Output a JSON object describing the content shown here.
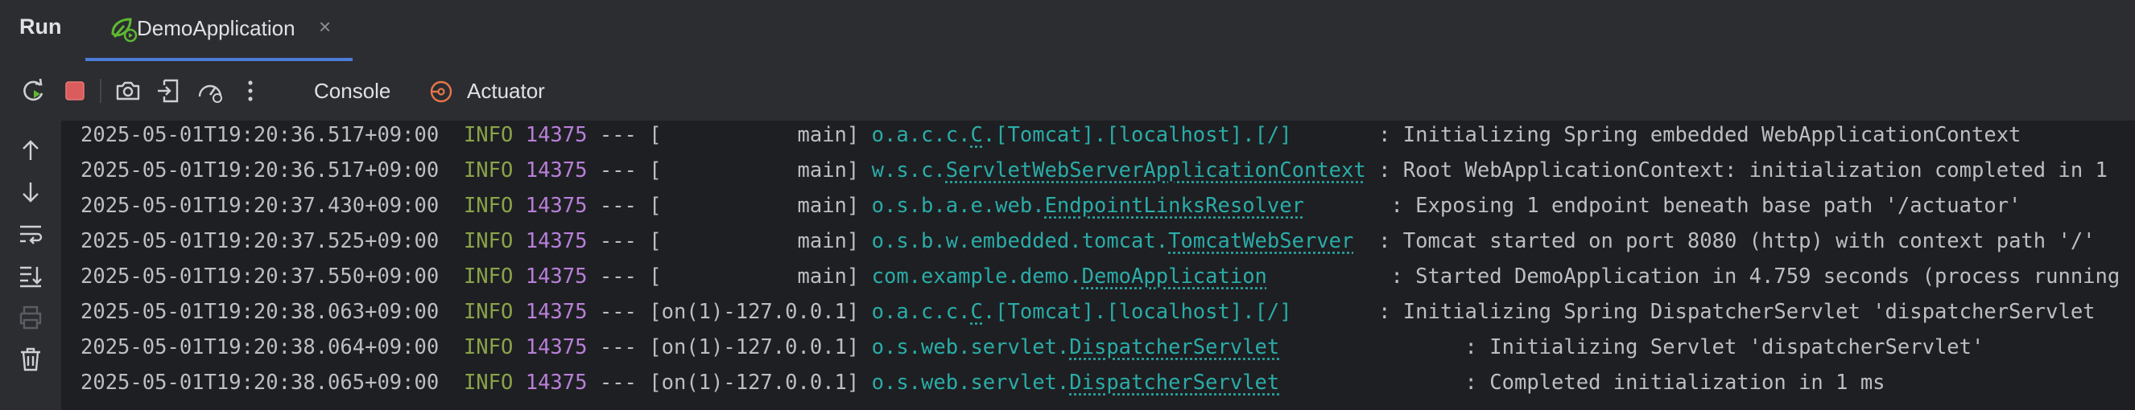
{
  "panel_title": "Run",
  "tab": {
    "label": "DemoApplication",
    "close": "×"
  },
  "toolbar": {
    "subtabs": [
      {
        "label": "Console"
      },
      {
        "label": "Actuator"
      }
    ]
  },
  "colors": {
    "background": "#1e1f22",
    "panel": "#2b2d30",
    "info": "#8aa34a",
    "pid": "#b87fd8",
    "logger": "#2aaca8",
    "stop": "#db5c5c"
  },
  "log": [
    {
      "ts": "2025-05-01T19:20:36.517+09:00",
      "level": "INFO",
      "pid": "14375",
      "sep": "---",
      "thread": "[           main]",
      "logger_pre": "o.a.c.c.",
      "logger_ul": "C",
      "logger_post": ".[Tomcat].[localhost].[/]      ",
      "msg": " : Initializing Spring embedded WebApplicationContext"
    },
    {
      "ts": "2025-05-01T19:20:36.517+09:00",
      "level": "INFO",
      "pid": "14375",
      "sep": "---",
      "thread": "[           main]",
      "logger_pre": "w.s.c.",
      "logger_ul": "ServletWebServerApplicationContext",
      "logger_post": "",
      "msg": " : Root WebApplicationContext: initialization completed in 1"
    },
    {
      "ts": "2025-05-01T19:20:37.430+09:00",
      "level": "INFO",
      "pid": "14375",
      "sep": "---",
      "thread": "[           main]",
      "logger_pre": "o.s.b.a.e.web.",
      "logger_ul": "EndpointLinksResolver",
      "logger_post": "      ",
      "msg": " : Exposing 1 endpoint beneath base path '/actuator'"
    },
    {
      "ts": "2025-05-01T19:20:37.525+09:00",
      "level": "INFO",
      "pid": "14375",
      "sep": "---",
      "thread": "[           main]",
      "logger_pre": "o.s.b.w.embedded.tomcat.",
      "logger_ul": "TomcatWebServer",
      "logger_post": " ",
      "msg": " : Tomcat started on port 8080 (http) with context path '/'"
    },
    {
      "ts": "2025-05-01T19:20:37.550+09:00",
      "level": "INFO",
      "pid": "14375",
      "sep": "---",
      "thread": "[           main]",
      "logger_pre": "com.example.demo.",
      "logger_ul": "DemoApplication",
      "logger_post": "         ",
      "msg": " : Started DemoApplication in 4.759 seconds (process running"
    },
    {
      "ts": "2025-05-01T19:20:38.063+09:00",
      "level": "INFO",
      "pid": "14375",
      "sep": "---",
      "thread": "[on(1)-127.0.0.1]",
      "logger_pre": "o.a.c.c.",
      "logger_ul": "C",
      "logger_post": ".[Tomcat].[localhost].[/]      ",
      "msg": " : Initializing Spring DispatcherServlet 'dispatcherServlet"
    },
    {
      "ts": "2025-05-01T19:20:38.064+09:00",
      "level": "INFO",
      "pid": "14375",
      "sep": "---",
      "thread": "[on(1)-127.0.0.1]",
      "logger_pre": "o.s.web.servlet.",
      "logger_ul": "DispatcherServlet",
      "logger_post": "              ",
      "msg": " : Initializing Servlet 'dispatcherServlet'"
    },
    {
      "ts": "2025-05-01T19:20:38.065+09:00",
      "level": "INFO",
      "pid": "14375",
      "sep": "---",
      "thread": "[on(1)-127.0.0.1]",
      "logger_pre": "o.s.web.servlet.",
      "logger_ul": "DispatcherServlet",
      "logger_post": "              ",
      "msg": " : Completed initialization in 1 ms"
    }
  ]
}
